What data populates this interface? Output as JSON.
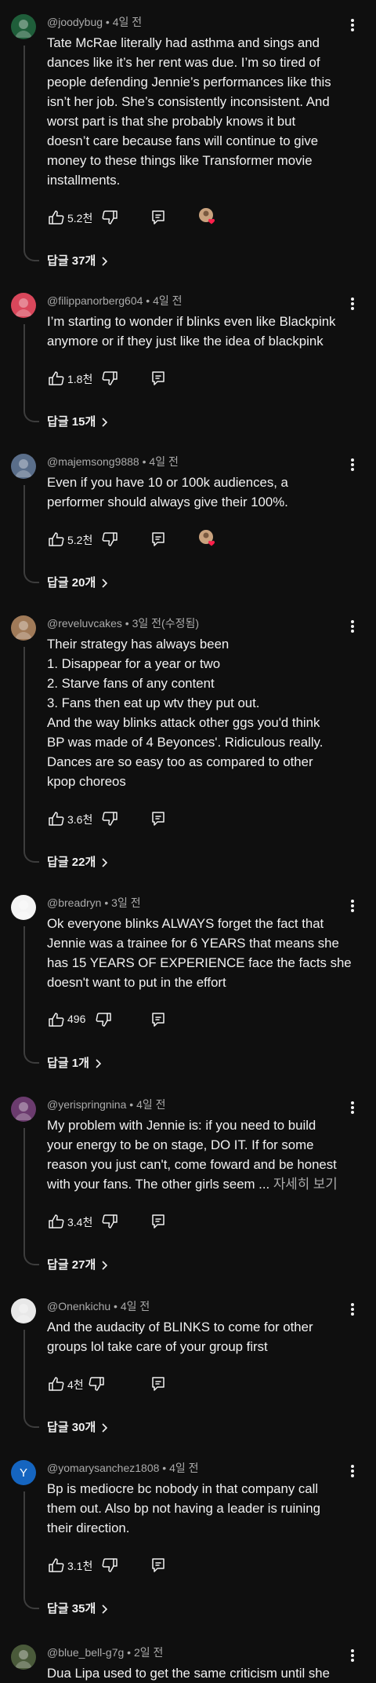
{
  "comments": [
    {
      "author": "@joodybug",
      "time": "4일 전",
      "lines": [
        "Tate McRae literally had asthma and sings and",
        "dances like it’s her rent was due. I’m so tired of",
        "people defending Jennie’s performances like this",
        "isn’t her job. She’s consistently inconsistent. And",
        "worst part is that she probably knows it but",
        "doesn’t care because fans will continue to give",
        "money to these things like Transformer movie",
        "installments."
      ],
      "read_more": "",
      "likes": "5.2천",
      "creator_heart": true,
      "replies": "답글 37개",
      "avatar_bg": "#1f5e3a",
      "avatar_letter": ""
    },
    {
      "author": "@filippanorberg604",
      "time": "4일 전",
      "lines": [
        "I’m starting to wonder if blinks even like Blackpink",
        "anymore or if they just like the idea of blackpink"
      ],
      "read_more": "",
      "likes": "1.8천",
      "creator_heart": false,
      "replies": "답글 15개",
      "avatar_bg": "#d9475b",
      "avatar_letter": ""
    },
    {
      "author": "@majemsong9888",
      "time": "4일 전",
      "lines": [
        "Even if you have 10 or 100k audiences, a",
        "performer should always give their 100%."
      ],
      "read_more": "",
      "likes": "5.2천",
      "creator_heart": true,
      "replies": "답글 20개",
      "avatar_bg": "#5a6e8a",
      "avatar_letter": ""
    },
    {
      "author": "@reveluvcakes",
      "time": "3일 전(수정됨)",
      "lines": [
        "Their strategy has always been",
        "1. Disappear for a year or two",
        "2. Starve fans of any content",
        "3. Fans then eat up wtv they put out.",
        "And the way blinks attack other ggs you'd think",
        "BP was made of 4 Beyonces'. Ridiculous really.",
        "Dances are so easy too as compared to other",
        "kpop choreos"
      ],
      "read_more": "",
      "likes": "3.6천",
      "creator_heart": false,
      "replies": "답글 22개",
      "avatar_bg": "#a07a58",
      "avatar_letter": ""
    },
    {
      "author": "@breadryn",
      "time": "3일 전",
      "lines": [
        "Ok everyone blinks ALWAYS forget the fact that",
        "Jennie was a trainee for 6 YEARS that means she",
        "has 15 YEARS OF EXPERIENCE face the facts she",
        "doesn't want to put in the effort"
      ],
      "read_more": "",
      "likes": "496",
      "creator_heart": false,
      "replies": "답글 1개",
      "avatar_bg": "#f4f4f4",
      "avatar_letter": ""
    },
    {
      "author": "@yerispringnina",
      "time": "4일 전",
      "lines": [
        "My problem with Jennie is: if you need to build",
        "your energy to be on stage, DO IT. If for some",
        "reason you just can't, come foward and be honest",
        "with your fans. The other girls seem ... "
      ],
      "read_more": "자세히 보기",
      "likes": "3.4천",
      "creator_heart": false,
      "replies": "답글 27개",
      "avatar_bg": "#6b3b6e",
      "avatar_letter": ""
    },
    {
      "author": "@Onenkichu",
      "time": "4일 전",
      "lines": [
        "And the audacity of BLINKS to come for other",
        "groups lol take care of your group first"
      ],
      "read_more": "",
      "likes": "4천",
      "creator_heart": false,
      "replies": "답글 30개",
      "avatar_bg": "#e8e8e8",
      "avatar_letter": ""
    },
    {
      "author": "@yomarysanchez1808",
      "time": "4일 전",
      "lines": [
        "Bp is mediocre bc nobody in that company call",
        "them out. Also bp not having a leader is ruining",
        "their direction."
      ],
      "read_more": "",
      "likes": "3.1천",
      "creator_heart": false,
      "replies": "답글 35개",
      "avatar_bg": "#1565c0",
      "avatar_letter": "Y"
    },
    {
      "author": "@blue_bell-g7g",
      "time": "2일 전",
      "lines": [
        "Dua Lipa used to get the same criticism until she"
      ],
      "read_more": "",
      "likes": "",
      "creator_heart": false,
      "replies": "",
      "avatar_bg": "#4a5a3a",
      "avatar_letter": ""
    }
  ]
}
